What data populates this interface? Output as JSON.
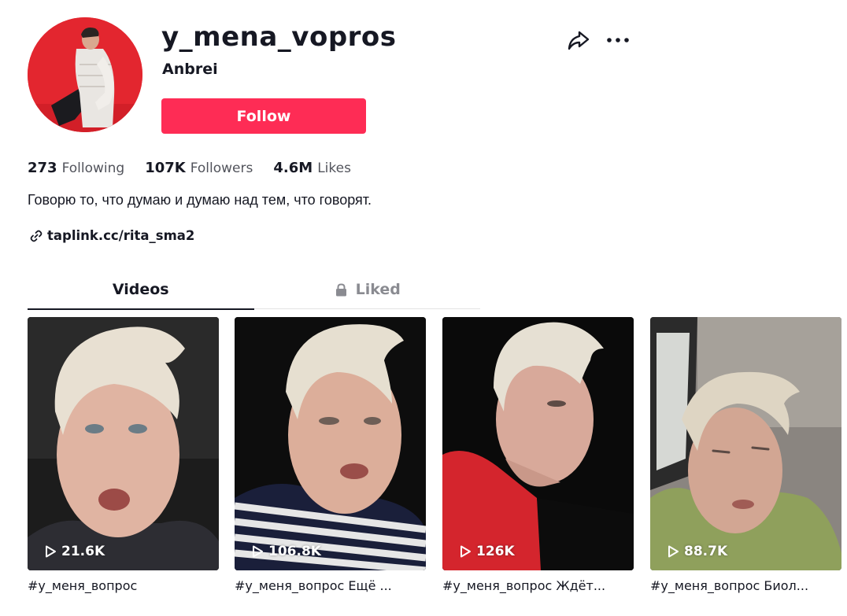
{
  "profile": {
    "username": "y_mena_vopros",
    "nickname": "Anbrei",
    "follow_label": "Follow",
    "bio": "Говорю то, что думаю и думаю над тем, что говорят.",
    "link": "taplink.cc/rita_sma2"
  },
  "stats": [
    {
      "value": "273",
      "label": "Following"
    },
    {
      "value": "107K",
      "label": "Followers"
    },
    {
      "value": "4.6M",
      "label": "Likes"
    }
  ],
  "tabs": [
    {
      "label": "Videos",
      "active": true
    },
    {
      "label": "Liked",
      "active": false,
      "icon": "lock-icon"
    }
  ],
  "videos": [
    {
      "views": "21.6K",
      "caption": "#у_меня_вопрос"
    },
    {
      "views": "106.8K",
      "caption": "#у_меня_вопрос Ещё ..."
    },
    {
      "views": "126K",
      "caption": "#у_меня_вопрос Ждёт..."
    },
    {
      "views": "88.7K",
      "caption": "#у_меня_вопрос Биол..."
    }
  ],
  "icons": {
    "share": "share-icon",
    "more": "more-icon",
    "link": "link-icon",
    "play": "play-icon"
  },
  "colors": {
    "brand": "#fe2c55",
    "text": "#161823"
  }
}
